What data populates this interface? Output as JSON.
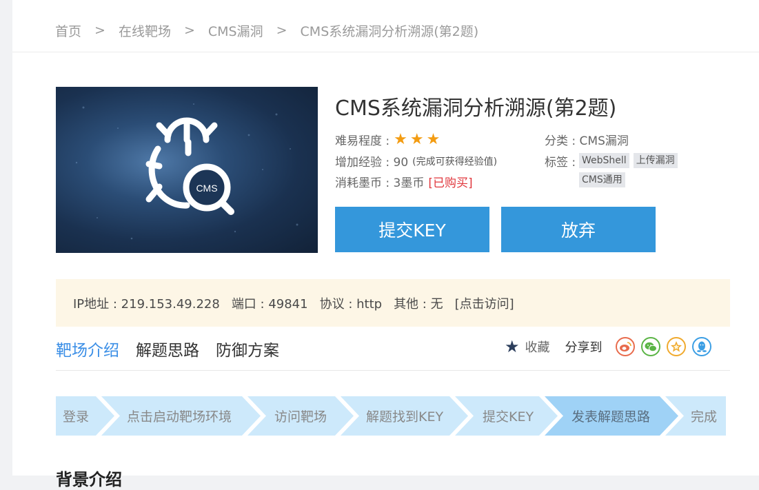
{
  "breadcrumb": {
    "items": [
      "首页",
      "在线靶场",
      "CMS漏洞",
      "CMS系统漏洞分析溯源(第2题)"
    ],
    "separator": ">"
  },
  "cover": {
    "label": "CMS"
  },
  "challenge": {
    "title": "CMS系统漏洞分析溯源(第2题)",
    "difficulty_label": "难易程度 :",
    "difficulty_stars": 3,
    "exp_label": "增加经验 : 90",
    "exp_note": "(完成可获得经验值)",
    "cost_label": "消耗墨币 : 3墨币",
    "purchased": "[已购买]",
    "category_label": "分类 : CMS漏洞",
    "tags_label": "标签 :",
    "tags": [
      "WebShell",
      "上传漏洞",
      "CMS通用"
    ]
  },
  "buttons": {
    "submit": "提交KEY",
    "quit": "放弃"
  },
  "infobar": {
    "ip": "IP地址 : 219.153.49.228",
    "port": "端口 : 49841",
    "protocol": "协议 : http",
    "other": "其他 : 无",
    "visit": "[点击访问]"
  },
  "tabs": [
    "靶场介绍",
    "解题思路",
    "防御方案"
  ],
  "actions": {
    "favorite": "收藏",
    "share": "分享到"
  },
  "steps": [
    "登录",
    "点击启动靶场环境",
    "访问靶场",
    "解题找到KEY",
    "提交KEY",
    "发表解题思路",
    "完成"
  ],
  "section_heading": "背景介绍",
  "colors": {
    "accent": "#3497db",
    "active_tab": "#3a8ee6",
    "star": "#f39c12",
    "purchased": "#e0353b",
    "info_bg": "#fdf6e6",
    "step_bg": "#cde9fb",
    "step_active_bg": "#9fd2f6"
  }
}
